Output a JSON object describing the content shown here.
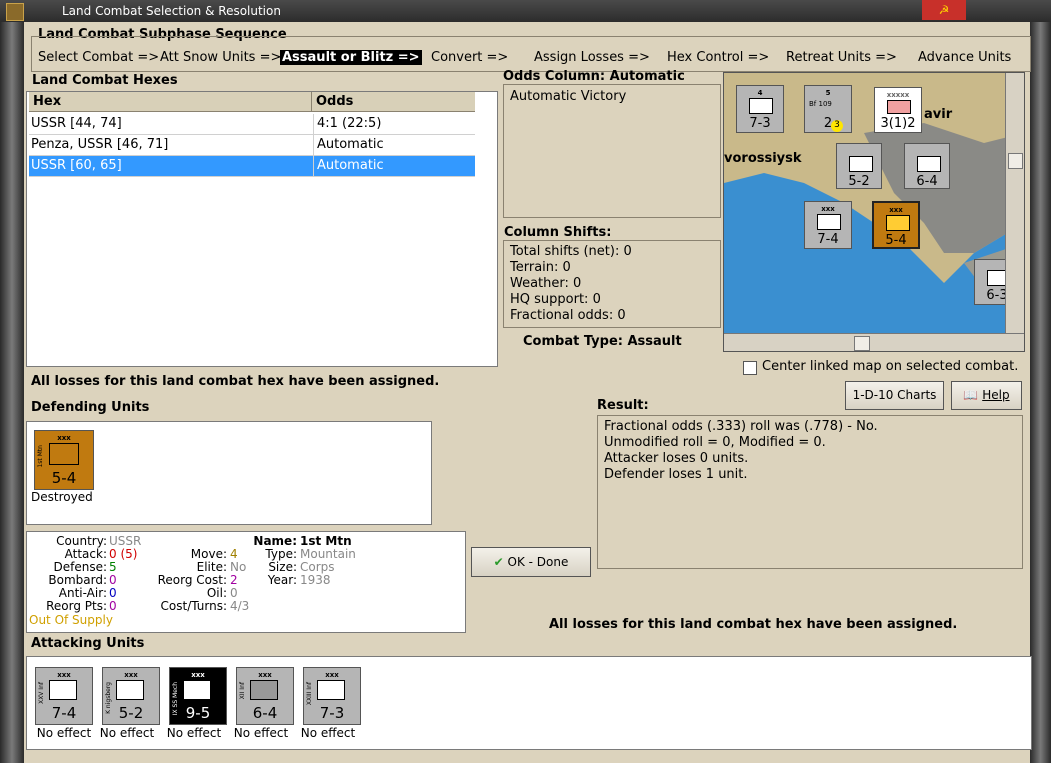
{
  "window": {
    "title": "Land Combat Selection & Resolution"
  },
  "sequence": {
    "heading": "Land Combat Subphase Sequence",
    "steps": [
      "Select Combat =>",
      "Att Snow Units =>",
      "Assault or Blitz =>",
      "Convert =>",
      "Assign Losses =>",
      "Hex Control =>",
      "Retreat Units =>",
      "Advance Units"
    ],
    "active_index": 2
  },
  "hexes": {
    "heading": "Land Combat Hexes",
    "columns": [
      "Hex",
      "Odds"
    ],
    "rows": [
      {
        "hex": "USSR [44, 74]",
        "odds": "4:1 (22:5)"
      },
      {
        "hex": "Penza, USSR [46, 71]",
        "odds": "Automatic"
      },
      {
        "hex": "USSR [60, 65]",
        "odds": "Automatic"
      }
    ],
    "selected_index": 2
  },
  "odds_column": {
    "label": "Odds Column: Automatic",
    "text": "Automatic Victory"
  },
  "column_shifts": {
    "heading": "Column Shifts:",
    "lines": [
      "Total shifts (net): 0",
      "Terrain: 0",
      "Weather: 0",
      "HQ support: 0",
      "Fractional odds: 0"
    ]
  },
  "combat_type": "Combat Type:  Assault",
  "map": {
    "center_checkbox_label": "Center linked map on selected combat.",
    "labels": [
      "vorossiysk",
      "avir"
    ],
    "units": [
      {
        "val": "7-3",
        "top": "4"
      },
      {
        "val": "2",
        "top": "5",
        "name": "Bf 109",
        "extra": "3"
      },
      {
        "val": "3(1)2",
        "top": "xxxxx"
      },
      {
        "val": "5-2",
        "top": "2"
      },
      {
        "val": "6-4",
        "top": "2"
      },
      {
        "val": "7-4",
        "top": "xxx"
      },
      {
        "val": "5-4",
        "top": "xxx"
      },
      {
        "val": "6-3",
        "top": ""
      }
    ]
  },
  "buttons": {
    "charts": "1-D-10 Charts",
    "help": "Help",
    "ok": "OK - Done"
  },
  "status_message": "All losses for this land combat hex have been assigned.",
  "defending": {
    "heading": "Defending Units",
    "units": [
      {
        "size": "xxx",
        "label": "1st Mtn",
        "value": "5-4",
        "result": "Destroyed"
      }
    ]
  },
  "result": {
    "heading": "Result:",
    "lines": [
      "Fractional odds (.333) roll was (.778)  - No.",
      "Unmodified roll = 0, Modified = 0.",
      "Attacker loses 0 units.",
      "Defender loses 1 unit."
    ]
  },
  "unit_info": {
    "country_k": "Country:",
    "country_v": "USSR",
    "attack_k": "Attack:",
    "attack_v": "0",
    "attack_v2": "(5)",
    "defense_k": "Defense:",
    "defense_v": "5",
    "bombard_k": "Bombard:",
    "bombard_v": "0",
    "antiair_k": "Anti-Air:",
    "antiair_v": "0",
    "reorgpts_k": "Reorg Pts:",
    "reorgpts_v": "0",
    "supply": "Out Of Supply",
    "move_k": "Move:",
    "move_v": "4",
    "elite_k": "Elite:",
    "elite_v": "No",
    "reorgcost_k": "Reorg Cost:",
    "reorgcost_v": "2",
    "oil_k": "Oil:",
    "oil_v": "0",
    "costturns_k": "Cost/Turns:",
    "costturns_v": "4/3",
    "name_k": "Name:",
    "name_v": "1st Mtn",
    "type_k": "Type:",
    "type_v": "Mountain",
    "size_k": "Size:",
    "size_v": "Corps",
    "year_k": "Year:",
    "year_v": "1938"
  },
  "attacking": {
    "heading": "Attacking Units",
    "units": [
      {
        "size": "xxx",
        "label": "XXV Inf",
        "value": "7-4",
        "result": "No effect"
      },
      {
        "size": "xxx",
        "label": "K nigsberg",
        "value": "5-2",
        "result": "No effect"
      },
      {
        "size": "xxx",
        "label": "IX SS Mech",
        "value": "9-5",
        "result": "No effect"
      },
      {
        "size": "xxx",
        "label": "XII Inf",
        "value": "6-4",
        "result": "No effect"
      },
      {
        "size": "xxx",
        "label": "XXIII Inf",
        "value": "7-3",
        "result": "No effect"
      }
    ]
  }
}
